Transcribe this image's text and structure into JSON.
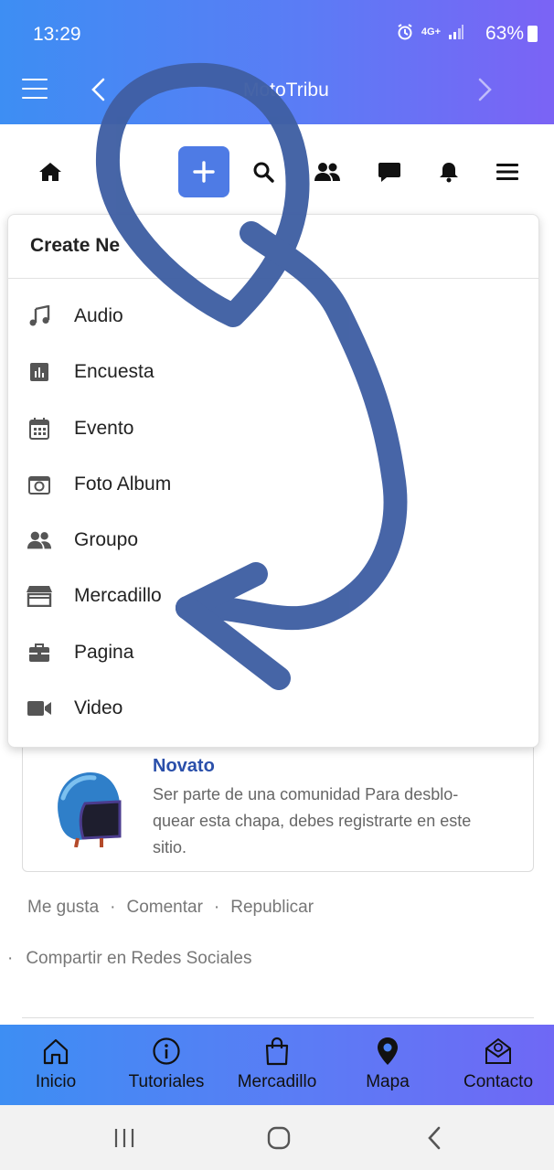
{
  "status_bar": {
    "time": "13:29",
    "network": "4G+",
    "battery": "63%"
  },
  "header": {
    "title": "MotoTribu"
  },
  "toolbar": {
    "items": [
      "home-icon",
      "add-icon",
      "search-icon",
      "users-icon",
      "chat-icon",
      "bell-icon",
      "menu-icon"
    ]
  },
  "dropdown": {
    "title": "Create Ne",
    "items": [
      {
        "label": "Audio",
        "icon": "music-icon"
      },
      {
        "label": "Encuesta",
        "icon": "poll-icon"
      },
      {
        "label": "Evento",
        "icon": "calendar-icon"
      },
      {
        "label": "Foto Album",
        "icon": "photo-album-icon"
      },
      {
        "label": "Groupo",
        "icon": "group-icon"
      },
      {
        "label": "Mercadillo",
        "icon": "store-icon"
      },
      {
        "label": "Pagina",
        "icon": "briefcase-icon"
      },
      {
        "label": "Video",
        "icon": "video-icon"
      }
    ]
  },
  "badge": {
    "title": "Novato",
    "description": "Ser parte de una comunidad Para desblo-quear esta chapa, debes registrarte en este sitio."
  },
  "post_actions": {
    "like": "Me gusta",
    "comment": "Comentar",
    "repost": "Republicar",
    "separator": "·",
    "share": "Compartir en Redes Sociales"
  },
  "bottom_nav": [
    {
      "label": "Inicio",
      "icon": "home-outline-icon"
    },
    {
      "label": "Tutoriales",
      "icon": "info-icon"
    },
    {
      "label": "Mercadillo",
      "icon": "shopping-bag-icon"
    },
    {
      "label": "Mapa",
      "icon": "map-pin-icon"
    },
    {
      "label": "Contacto",
      "icon": "mail-icon"
    }
  ],
  "colors": {
    "header_gradient_start": "#3d8ef3",
    "header_gradient_end": "#7b63f5",
    "add_button": "#4e7be5",
    "badge_title": "#2a4faa",
    "scribble": "#3f5fa3"
  }
}
